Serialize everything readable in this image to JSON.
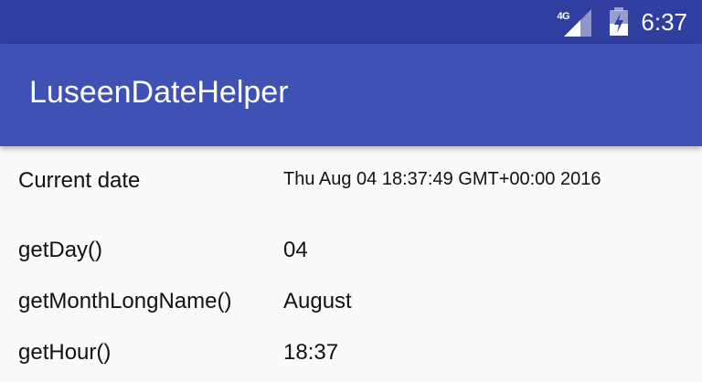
{
  "status_bar": {
    "network": "4G",
    "time": "6:37",
    "icons": [
      "signal-icon",
      "battery-icon"
    ]
  },
  "app_bar": {
    "title": "LuseenDateHelper"
  },
  "rows": [
    {
      "label": "Current date",
      "value": "Thu Aug 04 18:37:49 GMT+00:00 2016"
    },
    {
      "label": "getDay()",
      "value": "04"
    },
    {
      "label": "getMonthLongName()",
      "value": "August"
    },
    {
      "label": "getHour()",
      "value": "18:37"
    }
  ],
  "colors": {
    "status_bar": "#303f9f",
    "primary": "#3f51b5",
    "background": "#fafafa"
  }
}
